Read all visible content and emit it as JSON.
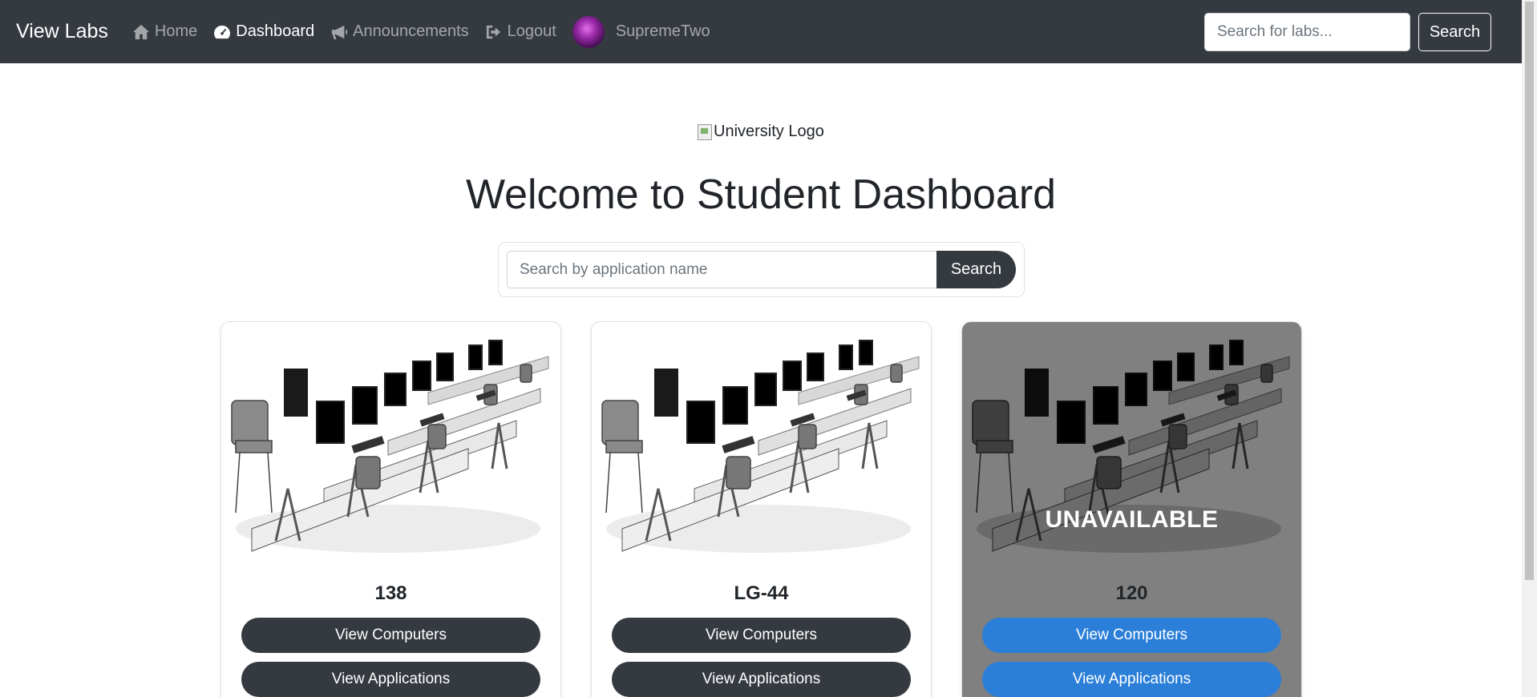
{
  "navbar": {
    "brand": "View Labs",
    "items": [
      {
        "label": "Home",
        "icon": "home-icon",
        "active": false
      },
      {
        "label": "Dashboard",
        "icon": "dashboard-icon",
        "active": true
      },
      {
        "label": "Announcements",
        "icon": "megaphone-icon",
        "active": false
      },
      {
        "label": "Logout",
        "icon": "logout-icon",
        "active": false
      }
    ],
    "username": "SupremeTwo",
    "search_placeholder": "Search for labs...",
    "search_button": "Search"
  },
  "main": {
    "logo_alt": "University Logo",
    "title": "Welcome to Student Dashboard",
    "search_placeholder": "Search by application name",
    "search_button": "Search"
  },
  "labs": [
    {
      "name": "138",
      "status": "available",
      "view_computers": "View Computers",
      "view_applications": "View Applications"
    },
    {
      "name": "LG-44",
      "status": "available",
      "view_computers": "View Computers",
      "view_applications": "View Applications"
    },
    {
      "name": "120",
      "status": "unavailable",
      "overlay": "UNAVAILABLE",
      "view_computers": "View Computers",
      "view_applications": "View Applications"
    }
  ],
  "colors": {
    "navbar_bg": "#343a40",
    "button_dark": "#343a40",
    "button_blue": "#2b7fd8",
    "unavailable_card_bg": "#808080",
    "monitor_screen": "#0a74e8"
  }
}
